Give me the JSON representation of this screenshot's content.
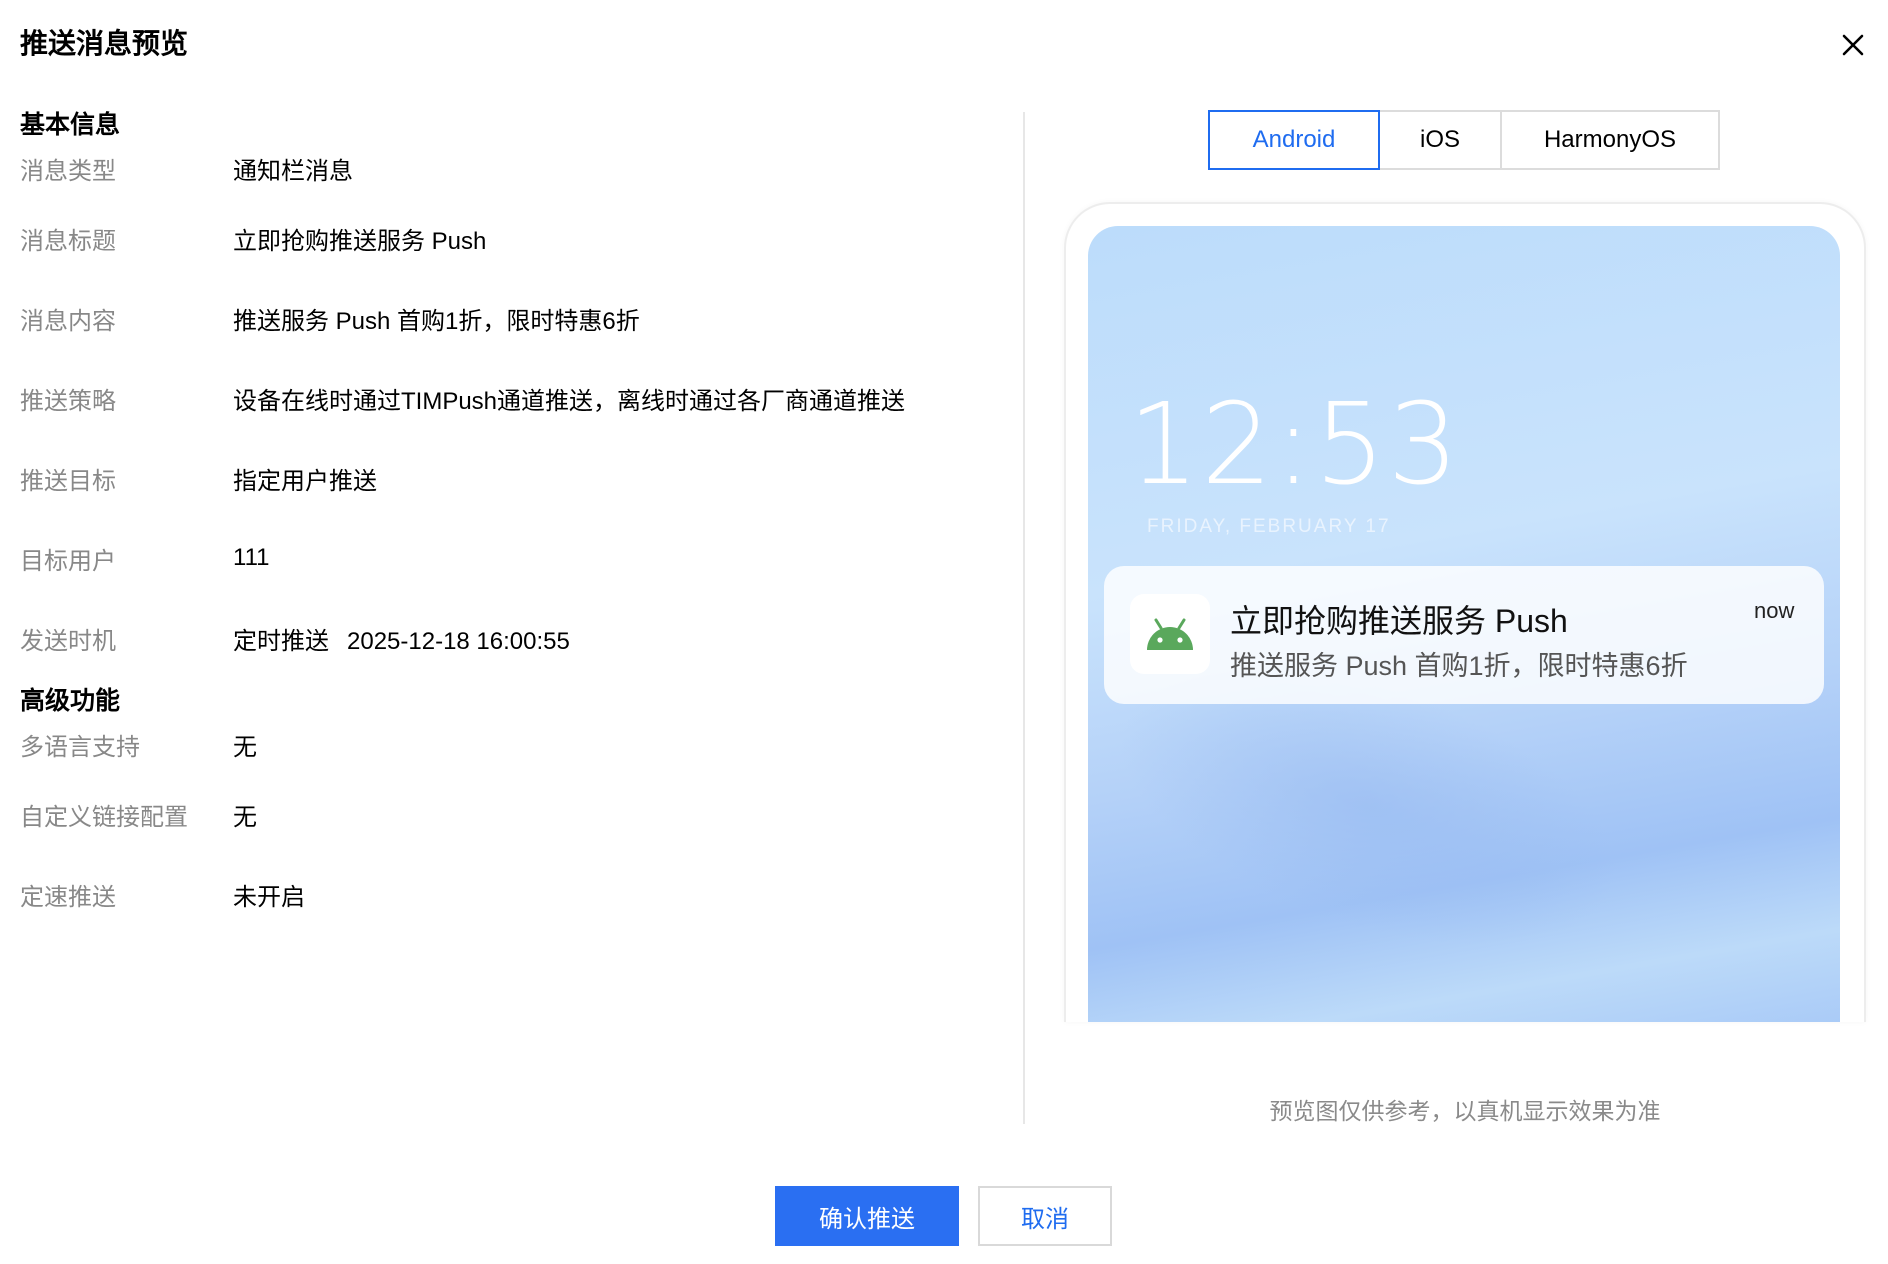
{
  "dialog": {
    "title": "推送消息预览"
  },
  "basic_info": {
    "section_title": "基本信息",
    "fields": [
      {
        "label": "消息类型",
        "value": "通知栏消息"
      },
      {
        "label": "消息标题",
        "value": "立即抢购推送服务 Push"
      },
      {
        "label": "消息内容",
        "value": "推送服务 Push 首购1折，限时特惠6折"
      },
      {
        "label": "推送策略",
        "value": "设备在线时通过TIMPush通道推送，离线时通过各厂商通道推送"
      },
      {
        "label": "推送目标",
        "value": "指定用户推送"
      },
      {
        "label": "目标用户",
        "value": "111"
      },
      {
        "label": "发送时机",
        "value_type": "定时推送",
        "value_time": "2025-12-18 16:00:55"
      }
    ]
  },
  "advanced": {
    "section_title": "高级功能",
    "fields": [
      {
        "label": "多语言支持",
        "value": "无"
      },
      {
        "label": "自定义链接配置",
        "value": "无"
      },
      {
        "label": "定速推送",
        "value": "未开启"
      }
    ]
  },
  "preview": {
    "tabs": [
      {
        "label": "Android",
        "active": true
      },
      {
        "label": "iOS",
        "active": false
      },
      {
        "label": "HarmonyOS",
        "active": false
      }
    ],
    "clock": "12:53",
    "date": "FRIDAY, FEBRUARY 17",
    "notification": {
      "title": "立即抢购推送服务 Push",
      "body": "推送服务 Push 首购1折，限时特惠6折",
      "time": "now",
      "icon": "android-icon"
    },
    "note": "预览图仅供参考，以真机显示效果为准"
  },
  "footer": {
    "confirm_label": "确认推送",
    "cancel_label": "取消"
  },
  "colors": {
    "primary": "#2a6ff2",
    "android_green": "#5aa85c",
    "label_gray": "#888888"
  }
}
